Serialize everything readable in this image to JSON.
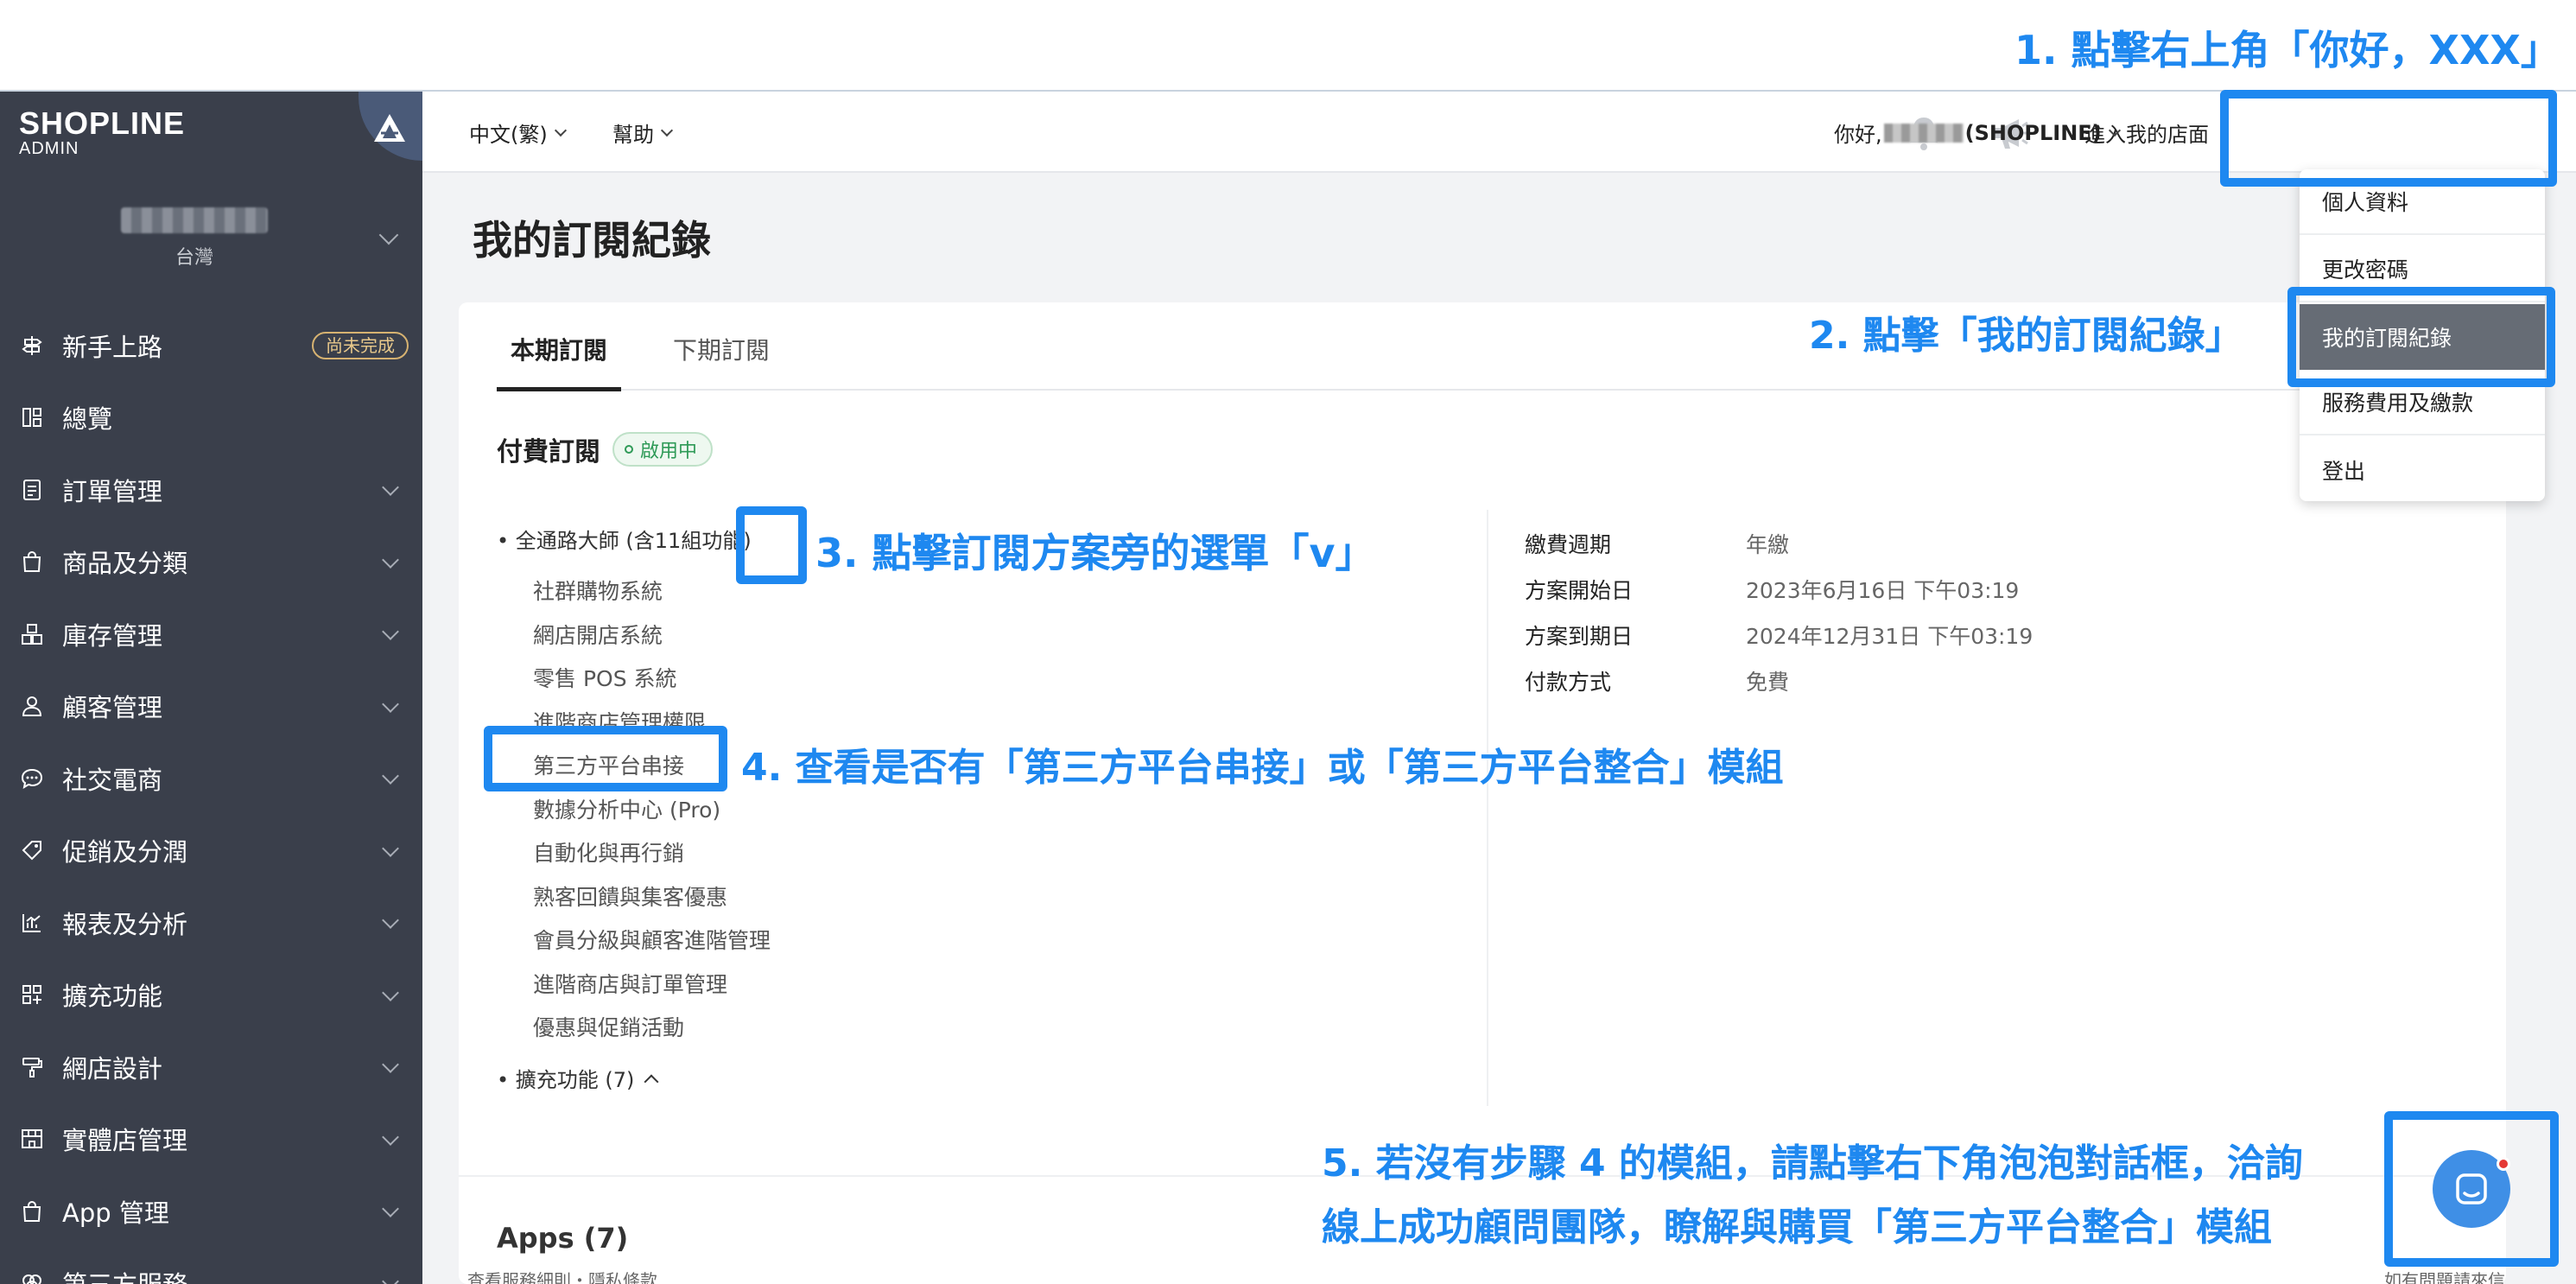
{
  "sidebar": {
    "logo_main": "SHOPLINE",
    "logo_sub": "ADMIN",
    "store_region": "台灣",
    "items": [
      {
        "label": "新手上路",
        "icon": "signpost-icon",
        "badge": "尚未完成"
      },
      {
        "label": "總覽",
        "icon": "dashboard-icon"
      },
      {
        "label": "訂單管理",
        "icon": "clipboard-icon"
      },
      {
        "label": "商品及分類",
        "icon": "shopping-bag-icon"
      },
      {
        "label": "庫存管理",
        "icon": "inventory-icon"
      },
      {
        "label": "顧客管理",
        "icon": "person-icon"
      },
      {
        "label": "社交電商",
        "icon": "chat-bubble-icon"
      },
      {
        "label": "促銷及分潤",
        "icon": "tag-icon"
      },
      {
        "label": "報表及分析",
        "icon": "bar-chart-icon"
      },
      {
        "label": "擴充功能",
        "icon": "apps-grid-icon"
      },
      {
        "label": "網店設計",
        "icon": "paint-roller-icon"
      },
      {
        "label": "實體店管理",
        "icon": "storefront-icon"
      },
      {
        "label": "App 管理",
        "icon": "app-bag-icon"
      },
      {
        "label": "第三方服務",
        "icon": "integration-icon"
      }
    ]
  },
  "header": {
    "language": "中文(繁)",
    "help": "幫助",
    "visit_store": "進入我的店面",
    "greeting_prefix": "你好, ",
    "greeting_name": "(SHOPLINE)"
  },
  "dropdown": {
    "items": [
      "個人資料",
      "更改密碼",
      "我的訂閱紀錄",
      "服務費用及繳款",
      "登出"
    ]
  },
  "page": {
    "title": "我的訂閱紀錄",
    "tabs": [
      "本期訂閱",
      "下期訂閱"
    ],
    "section_title": "付費訂閱",
    "status_badge": "啟用中",
    "plan_name": "全通路大師 (含11組功能)",
    "modules": [
      "社群購物系統",
      "網店開店系統",
      "零售 POS 系統",
      "進階商店管理權限",
      "第三方平台串接",
      "數據分析中心 (Pro)",
      "自動化與再行銷",
      "熟客回饋與集客優惠",
      "會員分級與顧客進階管理",
      "進階商店與訂單管理",
      "優惠與促銷活動"
    ],
    "addons": "擴充功能 (7)",
    "info": [
      {
        "key": "繳費週期",
        "value": "年繳"
      },
      {
        "key": "方案開始日",
        "value": "2023年6月16日 下午03:19"
      },
      {
        "key": "方案到期日",
        "value": "2024年12月31日 下午03:19"
      },
      {
        "key": "付款方式",
        "value": "免費"
      }
    ],
    "apps_title": "Apps (7)",
    "footer_links": "查看服務細則・隱私條款",
    "footer_right": "如有問題請來信"
  },
  "annotations": {
    "step1": "1. 點擊右上角「你好，XXX」",
    "step2": "2. 點擊「我的訂閱紀錄」",
    "step3": "3. 點擊訂閱方案旁的選單「v」",
    "step4": "4. 查看是否有「第三方平台串接」或「第三方平台整合」模組",
    "step5_line1": "5. 若沒有步驟 4 的模組，請點擊右下角泡泡對話框，洽詢",
    "step5_line2": "線上成功顧問團隊，瞭解與購買「第三方平台整合」模組"
  },
  "colors": {
    "annotation_blue": "#1e88f0",
    "sidebar_bg": "#3a3f4b",
    "active_green": "#2f9a57",
    "chat_blue": "#3f8fe6"
  }
}
